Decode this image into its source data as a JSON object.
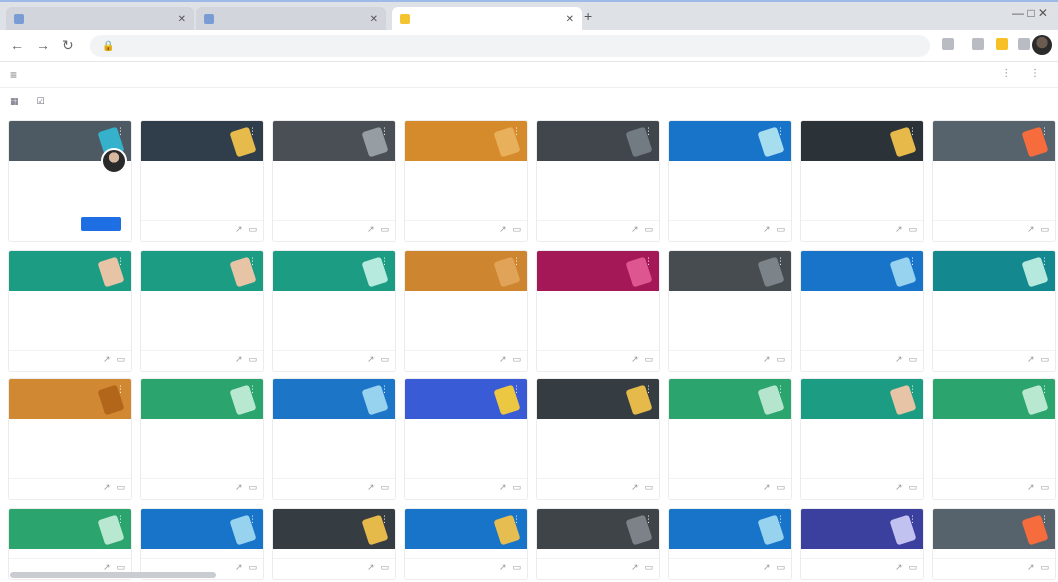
{
  "browser": {
    "tabs": [
      {
        "label": "",
        "color": "#7a9cd4",
        "active": false
      },
      {
        "label": "",
        "color": "#7a9cd4",
        "active": false
      },
      {
        "label": "",
        "color": "#f4c430",
        "active": true
      }
    ],
    "address": "",
    "new_tab": "+",
    "window_controls": "— □ ✕"
  },
  "app": {
    "menu_icon": "≡",
    "title": "",
    "right_icons": "⋮ ⋮",
    "subbar": [
      {
        "icon": "calendar-icon",
        "label": ""
      },
      {
        "icon": "todo-icon",
        "label": ""
      }
    ]
  },
  "invite": {
    "owner_text": "",
    "decline_label": "",
    "join_label": ""
  },
  "cards": [
    {
      "title": "",
      "subtitle": "",
      "color": "#4d5963",
      "art": "#35b6d1"
    },
    {
      "title": "",
      "subtitle": "",
      "color": "#2f3e4a",
      "art": "#f0c14b"
    },
    {
      "title": "",
      "subtitle": "",
      "color": "#4a4f55",
      "art": "#9aa1a8"
    },
    {
      "title": "",
      "subtitle": "",
      "color": "#d58a2c",
      "art": "#e9b25d"
    },
    {
      "title": "",
      "subtitle": "",
      "color": "#40464c",
      "art": "#767e85"
    },
    {
      "title": "",
      "subtitle": "",
      "color": "#1874c9",
      "art": "#aee4f2"
    },
    {
      "title": "",
      "subtitle": "",
      "color": "#2c3338",
      "art": "#f0c14b"
    },
    {
      "title": "",
      "subtitle": "",
      "color": "#56626c",
      "art": "#ff6d3b"
    },
    {
      "title": "",
      "subtitle": "",
      "color": "#1c9c82",
      "art": "#f1c6a6"
    },
    {
      "title": "",
      "subtitle": "",
      "color": "#1c9c82",
      "art": "#f1c6a6"
    },
    {
      "title": "",
      "subtitle": "",
      "color": "#1c9c82",
      "art": "#bfeee3"
    },
    {
      "title": "",
      "subtitle": "",
      "color": "#cd8530",
      "art": "#e1a45b"
    },
    {
      "title": "",
      "subtitle": "",
      "color": "#a41857",
      "art": "#e25a93"
    },
    {
      "title": "",
      "subtitle": "",
      "color": "#474c51",
      "art": "#7f868c"
    },
    {
      "title": "",
      "subtitle": "",
      "color": "#1874c9",
      "art": "#9ed8f0"
    },
    {
      "title": "",
      "subtitle": "",
      "color": "#13898f",
      "art": "#bfeee3"
    },
    {
      "title": "",
      "subtitle": "",
      "color": "#d18832",
      "art": "#b06418"
    },
    {
      "title": "",
      "subtitle": "",
      "color": "#2ca46e",
      "art": "#c1ecd5"
    },
    {
      "title": "",
      "subtitle": "",
      "color": "#1c75c6",
      "art": "#9ed8f0"
    },
    {
      "title": "",
      "subtitle": "",
      "color": "#3a5bd6",
      "art": "#f5cf3a"
    },
    {
      "title": "",
      "subtitle": "",
      "color": "#353c42",
      "art": "#f0c14b"
    },
    {
      "title": "",
      "subtitle": "",
      "color": "#2ca46e",
      "art": "#bde9d2"
    },
    {
      "title": "",
      "subtitle": "",
      "color": "#1c9c82",
      "art": "#f1c6a6"
    },
    {
      "title": "",
      "subtitle": "",
      "color": "#2ca46e",
      "art": "#c1ecd5"
    },
    {
      "title": "",
      "subtitle": "",
      "color": "#2ca46e",
      "art": "#c1ecd5"
    },
    {
      "title": "",
      "subtitle": "",
      "color": "#1874c9",
      "art": "#9ed8f0"
    },
    {
      "title": "",
      "subtitle": "",
      "color": "#353c42",
      "art": "#f0c14b"
    },
    {
      "title": "",
      "subtitle": "",
      "color": "#1874c9",
      "art": "#f0c14b"
    },
    {
      "title": "",
      "subtitle": "",
      "color": "#3f4449",
      "art": "#7f868c"
    },
    {
      "title": "",
      "subtitle": "",
      "color": "#1874c9",
      "art": "#9ed8f0"
    },
    {
      "title": "",
      "subtitle": "",
      "color": "#3b3f9e",
      "art": "#c9c9f5"
    },
    {
      "title": "",
      "subtitle": "",
      "color": "#56626c",
      "art": "#ff6d3b"
    }
  ],
  "footer_icons": {
    "assign": "↗",
    "folder": "▭"
  }
}
